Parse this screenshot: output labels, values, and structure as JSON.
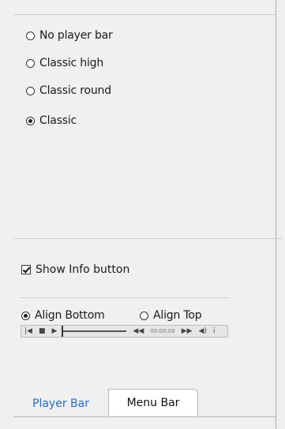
{
  "player_bar_style": {
    "options": [
      {
        "label": "No player bar",
        "checked": false
      },
      {
        "label": "Classic high",
        "checked": false
      },
      {
        "label": "Classic round",
        "checked": false
      },
      {
        "label": "Classic",
        "checked": true
      }
    ]
  },
  "show_info_button": {
    "label": "Show Info button",
    "checked": true
  },
  "alignment": {
    "options": [
      {
        "label": "Align Bottom",
        "checked": true
      },
      {
        "label": "Align Top",
        "checked": false
      }
    ]
  },
  "preview_bar": {
    "time": "00:00:00",
    "icons": [
      "skip-start-icon",
      "stop-icon",
      "play-icon",
      "rewind-icon",
      "fast-forward-icon",
      "volume-icon",
      "info-icon"
    ]
  },
  "tabs": [
    {
      "label": "Player Bar",
      "active": true
    },
    {
      "label": "Menu Bar",
      "active": false
    }
  ]
}
